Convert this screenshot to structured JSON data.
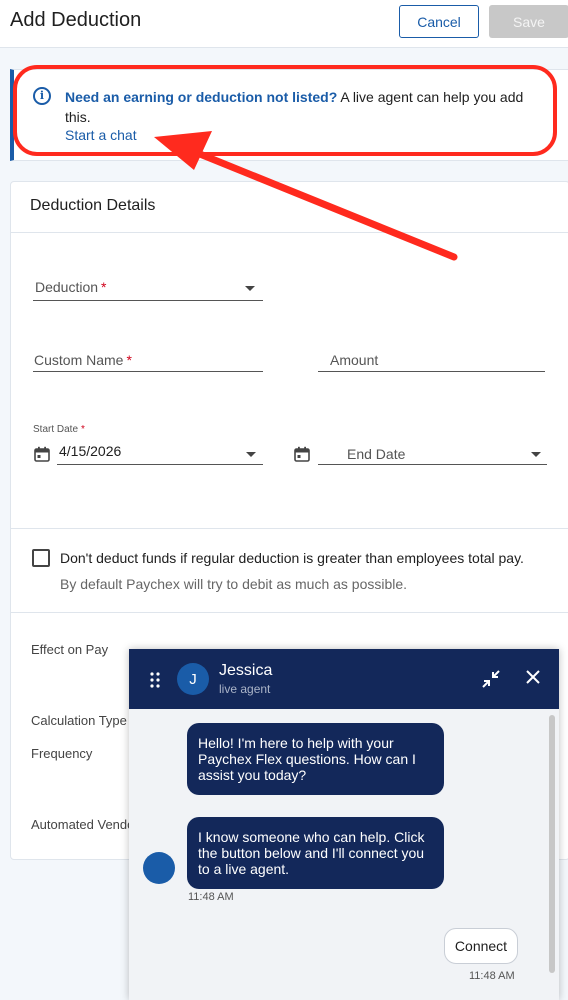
{
  "header": {
    "title": "Add Deduction",
    "cancel_label": "Cancel",
    "save_label": "Save"
  },
  "banner": {
    "icon": "info-icon",
    "strong_text": "Need an earning or deduction not listed?",
    "rest_text": " A live agent can help you add this.",
    "link_label": "Start a chat"
  },
  "details": {
    "title": "Deduction Details",
    "deduction_label": "Deduction",
    "custom_name_label": "Custom Name",
    "amount_label": "Amount",
    "start_date_label": "Start Date",
    "start_date_value": "4/15/2026",
    "end_date_label": "End Date",
    "required_mark": "*"
  },
  "checkbox": {
    "label": "Don't deduct funds if regular deduction is greater than employees total pay.",
    "sub": "By default Paychex will try to debit as much as possible.",
    "checked": false
  },
  "lower_fields": {
    "effect_on_pay": "Effect on Pay",
    "calculation_type": "Calculation Type",
    "frequency": "Frequency",
    "automated_vendor": "Automated Vendo"
  },
  "chat": {
    "agent_initial": "J",
    "agent_name": "Jessica",
    "agent_role": "live agent",
    "messages": [
      {
        "text": "Hello! I'm here to help with your Paychex Flex questions. How can I assist you today?"
      },
      {
        "text": "I know someone who can help. Click the button below and I'll connect you to a live agent.",
        "time": "11:48 AM"
      }
    ],
    "connect_label": "Connect",
    "connect_time": "11:48 AM"
  },
  "colors": {
    "brand": "#1a5ca8",
    "navy": "#13285a",
    "annotation": "#ff2a1e"
  }
}
